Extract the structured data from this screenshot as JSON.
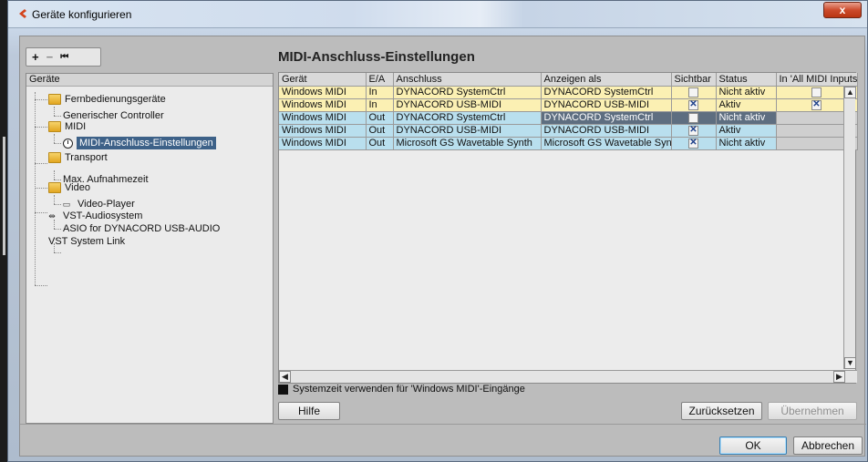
{
  "window": {
    "title": "Geräte konfigurieren",
    "close_label": "x"
  },
  "left_toolbar": {
    "add": "+",
    "remove": "−",
    "reset": "⏮"
  },
  "tree": {
    "header": "Geräte",
    "items": [
      {
        "label": "Fernbedienungsgeräte",
        "icon": "folder-icon"
      },
      {
        "label": "Generischer Controller",
        "icon": ""
      },
      {
        "label": "MIDI",
        "icon": "folder-icon"
      },
      {
        "label": "MIDI-Anschluss-Einstellungen",
        "icon": "clock-icon",
        "selected": true
      },
      {
        "label": "Transport",
        "icon": "folder-icon"
      },
      {
        "label": "Max. Aufnahmezeit",
        "icon": ""
      },
      {
        "label": "Video",
        "icon": "folder-icon"
      },
      {
        "label": "Video-Player",
        "icon": "video-icon"
      },
      {
        "label": "VST-Audiosystem",
        "icon": "audio-icon"
      },
      {
        "label": "ASIO for DYNACORD USB-AUDIO",
        "icon": ""
      },
      {
        "label": "VST System Link",
        "icon": ""
      }
    ]
  },
  "main": {
    "title": "MIDI-Anschluss-Einstellungen",
    "columns": [
      "Gerät",
      "E/A",
      "Anschluss",
      "Anzeigen als",
      "Sichtbar",
      "Status",
      "In 'All MIDI Inputs'"
    ],
    "rows": [
      {
        "geraet": "Windows MIDI",
        "ea": "In",
        "anschluss": "DYNACORD SystemCtrl",
        "anzeigen": "DYNACORD SystemCtrl",
        "sichtbar": "",
        "status": "Nicht aktiv",
        "allmidi": ""
      },
      {
        "geraet": "Windows MIDI",
        "ea": "In",
        "anschluss": "DYNACORD USB-MIDI",
        "anzeigen": "DYNACORD USB-MIDI",
        "sichtbar": "✕",
        "status": "Aktiv",
        "allmidi": "✕"
      },
      {
        "geraet": "Windows MIDI",
        "ea": "Out",
        "anschluss": "DYNACORD SystemCtrl",
        "anzeigen": "DYNACORD SystemCtrl",
        "sichtbar": "",
        "status": "Nicht aktiv",
        "allmidi": null
      },
      {
        "geraet": "Windows MIDI",
        "ea": "Out",
        "anschluss": "DYNACORD USB-MIDI",
        "anzeigen": "DYNACORD USB-MIDI",
        "sichtbar": "✕",
        "status": "Aktiv",
        "allmidi": null
      },
      {
        "geraet": "Windows MIDI",
        "ea": "Out",
        "anschluss": "Microsoft GS Wavetable Synth",
        "anzeigen": "Microsoft GS Wavetable Synth",
        "sichtbar": "✕",
        "status": "Nicht aktiv",
        "allmidi": null
      }
    ],
    "system_time_label": "Systemzeit verwenden für 'Windows MIDI'-Eingänge"
  },
  "buttons": {
    "help": "Hilfe",
    "reset": "Zurücksetzen",
    "apply": "Übernehmen",
    "ok": "OK",
    "cancel": "Abbrechen"
  }
}
